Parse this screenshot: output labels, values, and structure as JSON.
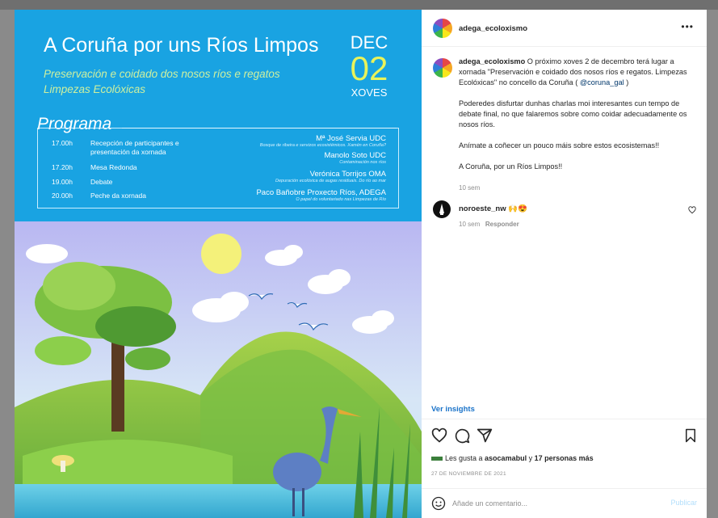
{
  "poster": {
    "title": "A Coruña por uns Ríos Limpos",
    "subtitle": "Preservación e coidado dos nosos ríos e regatos Limpezas Ecolóxicas",
    "month": "DEC",
    "day": "02",
    "weekday": "XOVES",
    "programa_label": "Programa",
    "schedule": [
      {
        "time": "17.00h",
        "desc": "Recepción de participantes e presentación da xornada"
      },
      {
        "time": "17.20h",
        "desc": "Mesa Redonda"
      },
      {
        "time": "19.00h",
        "desc": "Debate"
      },
      {
        "time": "20.00h",
        "desc": "Peche da xornada"
      }
    ],
    "speakers": [
      {
        "name": "Mª José Servia UDC",
        "role": "Bosque de ribeira e servizos ecosistémicos. Xamén en Coruña?"
      },
      {
        "name": "Manolo Soto UDC",
        "role": "Contaminación nos ríos"
      },
      {
        "name": "Verónica Torrijos OMA",
        "role": "Depuración ecolóxica de augas residuais. Do río ao mar"
      },
      {
        "name": "Paco Bañobre Proxecto Ríos, ADEGA",
        "role": "O papel do voluntariado nas Limpezas de Río"
      }
    ]
  },
  "post": {
    "header_username": "adega_ecoloxismo",
    "more_icon": "•••",
    "caption_username": "adega_ecoloxismo",
    "caption_text": " O próximo xoves 2 de decembro terá lugar a xornada \"Preservación e coidado dos nosos ríos e regatos. Limpezas Ecolóxicas\" no concello da Coruña ( ",
    "caption_mention": "@coruna_gal",
    "caption_close": " )",
    "caption_p2": "Poderedes disfurtar dunhas charlas moi interesantes cun tempo de debate final, no que falaremos sobre como coidar adecuadamente os nosos ríos.",
    "caption_p3": "Anímate a coñecer un pouco máis sobre estos ecosistemas!!",
    "caption_p4": "A Coruña, por un Ríos Limpos!!",
    "caption_time": "10 sem",
    "comment_username": "noroeste_nw",
    "comment_emoji": "🙌😍",
    "comment_time": "10 sem",
    "comment_reply": "Responder",
    "insights_label": "Ver insights",
    "likes_prefix": "Les gusta a ",
    "likes_user": "asocamabul",
    "likes_suffix": " y ",
    "likes_more": "17 personas más",
    "date": "27 DE NOVIEMBRE DE 2021",
    "comment_placeholder": "Añade un comentario...",
    "publish_label": "Publicar"
  },
  "colors": {
    "poster_blue": "#19a3e2",
    "link_blue": "#1a73c9",
    "text": "#262626",
    "muted": "#8e8e8e"
  }
}
